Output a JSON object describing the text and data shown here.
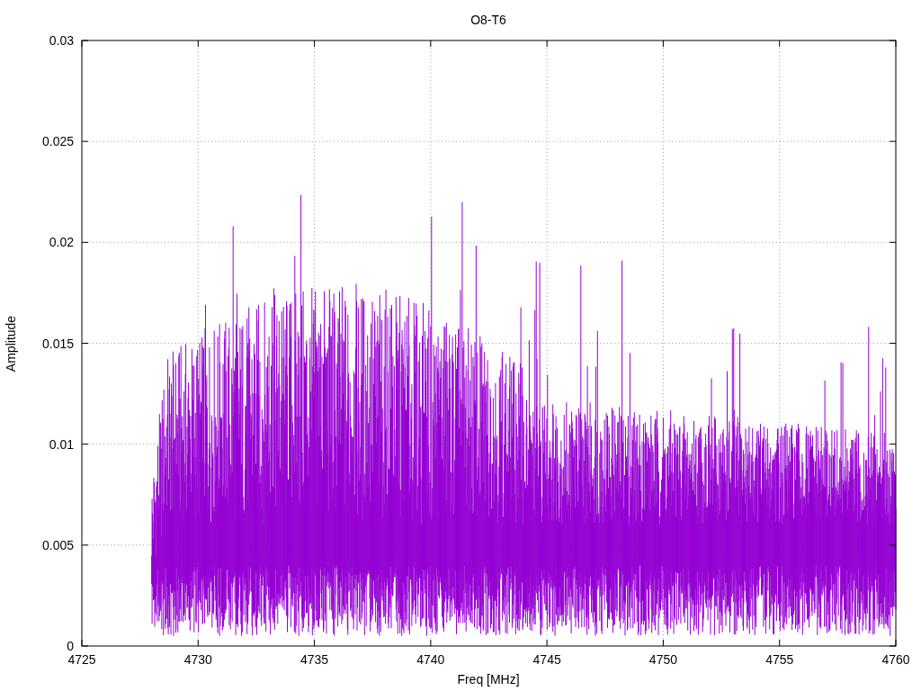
{
  "chart": {
    "title": "O8-T6",
    "xlabel": "Freq [MHz]",
    "ylabel": "Amplitude",
    "xticks": [
      "4725",
      "4730",
      "4735",
      "4740",
      "4745",
      "4750",
      "4755",
      "4760"
    ],
    "yticks": [
      "0.03",
      "0.025",
      "0.02",
      "0.015",
      "0.01",
      "0.005",
      "0"
    ]
  }
}
